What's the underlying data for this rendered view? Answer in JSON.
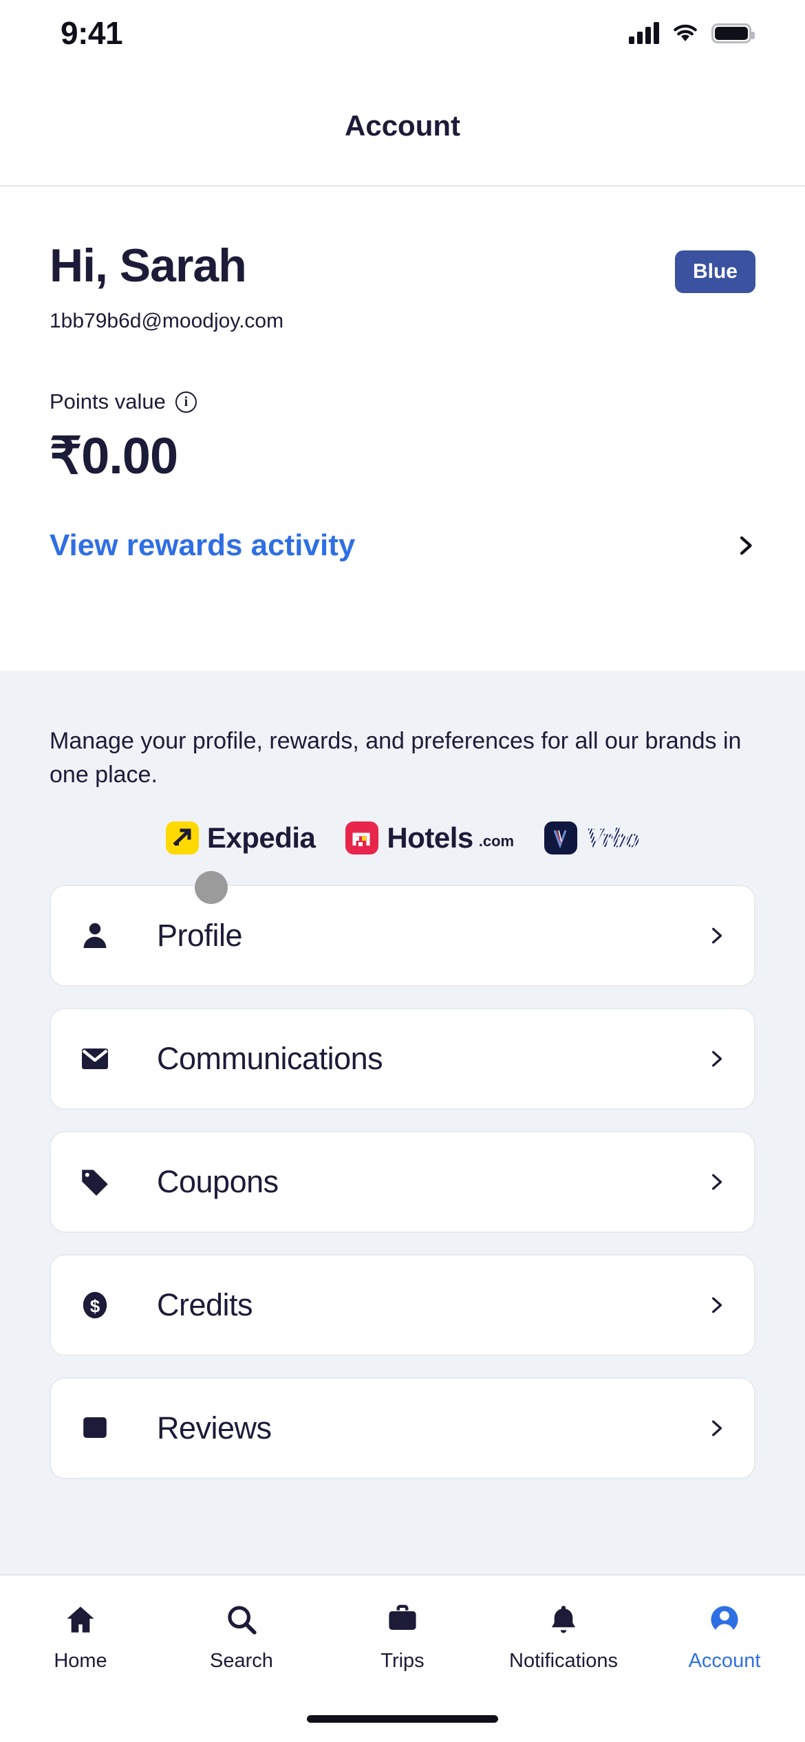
{
  "status_bar": {
    "time": "9:41",
    "signal_icon": "cellular-signal-icon",
    "wifi_icon": "wifi-icon",
    "battery_icon": "battery-icon"
  },
  "header": {
    "title": "Account"
  },
  "hero": {
    "greeting": "Hi, Sarah",
    "email": "1bb79b6d@moodjoy.com",
    "tier_badge": "Blue",
    "points_label": "Points value",
    "info_icon_glyph": "i",
    "points_value": "₹0.00",
    "rewards_link": "View rewards activity"
  },
  "brands_section": {
    "description": "Manage your profile, rewards, and preferences for all our brands in one place.",
    "brands": [
      {
        "name": "Expedia",
        "mark_color": "#ffd900",
        "suffix": ""
      },
      {
        "name": "Hotels",
        "mark_color": "#e8264c",
        "suffix": ".com"
      },
      {
        "name": "Vrbo",
        "mark_color": "#10173f",
        "suffix": ""
      }
    ]
  },
  "menu": {
    "items": [
      {
        "label": "Profile",
        "icon": "person-icon"
      },
      {
        "label": "Communications",
        "icon": "envelope-icon"
      },
      {
        "label": "Coupons",
        "icon": "tag-icon"
      },
      {
        "label": "Credits",
        "icon": "dollar-coin-icon"
      },
      {
        "label": "Reviews",
        "icon": "review-card-icon"
      }
    ]
  },
  "tab_bar": {
    "active": "Account",
    "tabs": [
      {
        "label": "Home",
        "icon": "home-icon"
      },
      {
        "label": "Search",
        "icon": "search-icon"
      },
      {
        "label": "Trips",
        "icon": "briefcase-icon"
      },
      {
        "label": "Notifications",
        "icon": "bell-icon"
      },
      {
        "label": "Account",
        "icon": "account-avatar-icon"
      }
    ]
  },
  "colors": {
    "accent_blue": "#2f6fe4",
    "tier_badge_blue": "#3a52a0",
    "ink": "#1c1b38",
    "gray_bg": "#eff2f7"
  }
}
